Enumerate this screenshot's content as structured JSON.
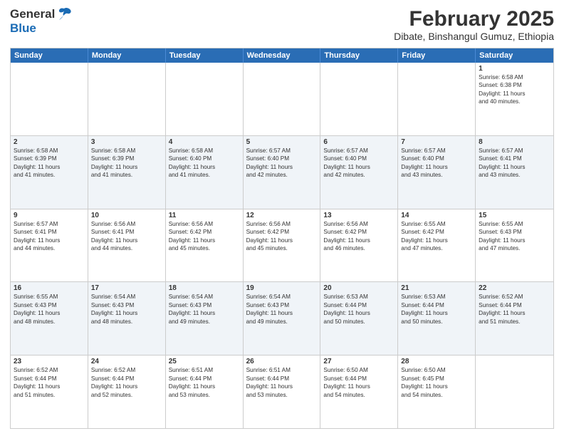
{
  "header": {
    "logo_general": "General",
    "logo_blue": "Blue",
    "title": "February 2025",
    "subtitle": "Dibate, Binshangul Gumuz, Ethiopia"
  },
  "days_of_week": [
    "Sunday",
    "Monday",
    "Tuesday",
    "Wednesday",
    "Thursday",
    "Friday",
    "Saturday"
  ],
  "weeks": [
    [
      {
        "day": "",
        "info": ""
      },
      {
        "day": "",
        "info": ""
      },
      {
        "day": "",
        "info": ""
      },
      {
        "day": "",
        "info": ""
      },
      {
        "day": "",
        "info": ""
      },
      {
        "day": "",
        "info": ""
      },
      {
        "day": "1",
        "info": "Sunrise: 6:58 AM\nSunset: 6:38 PM\nDaylight: 11 hours\nand 40 minutes."
      }
    ],
    [
      {
        "day": "2",
        "info": "Sunrise: 6:58 AM\nSunset: 6:39 PM\nDaylight: 11 hours\nand 41 minutes."
      },
      {
        "day": "3",
        "info": "Sunrise: 6:58 AM\nSunset: 6:39 PM\nDaylight: 11 hours\nand 41 minutes."
      },
      {
        "day": "4",
        "info": "Sunrise: 6:58 AM\nSunset: 6:40 PM\nDaylight: 11 hours\nand 41 minutes."
      },
      {
        "day": "5",
        "info": "Sunrise: 6:57 AM\nSunset: 6:40 PM\nDaylight: 11 hours\nand 42 minutes."
      },
      {
        "day": "6",
        "info": "Sunrise: 6:57 AM\nSunset: 6:40 PM\nDaylight: 11 hours\nand 42 minutes."
      },
      {
        "day": "7",
        "info": "Sunrise: 6:57 AM\nSunset: 6:40 PM\nDaylight: 11 hours\nand 43 minutes."
      },
      {
        "day": "8",
        "info": "Sunrise: 6:57 AM\nSunset: 6:41 PM\nDaylight: 11 hours\nand 43 minutes."
      }
    ],
    [
      {
        "day": "9",
        "info": "Sunrise: 6:57 AM\nSunset: 6:41 PM\nDaylight: 11 hours\nand 44 minutes."
      },
      {
        "day": "10",
        "info": "Sunrise: 6:56 AM\nSunset: 6:41 PM\nDaylight: 11 hours\nand 44 minutes."
      },
      {
        "day": "11",
        "info": "Sunrise: 6:56 AM\nSunset: 6:42 PM\nDaylight: 11 hours\nand 45 minutes."
      },
      {
        "day": "12",
        "info": "Sunrise: 6:56 AM\nSunset: 6:42 PM\nDaylight: 11 hours\nand 45 minutes."
      },
      {
        "day": "13",
        "info": "Sunrise: 6:56 AM\nSunset: 6:42 PM\nDaylight: 11 hours\nand 46 minutes."
      },
      {
        "day": "14",
        "info": "Sunrise: 6:55 AM\nSunset: 6:42 PM\nDaylight: 11 hours\nand 47 minutes."
      },
      {
        "day": "15",
        "info": "Sunrise: 6:55 AM\nSunset: 6:43 PM\nDaylight: 11 hours\nand 47 minutes."
      }
    ],
    [
      {
        "day": "16",
        "info": "Sunrise: 6:55 AM\nSunset: 6:43 PM\nDaylight: 11 hours\nand 48 minutes."
      },
      {
        "day": "17",
        "info": "Sunrise: 6:54 AM\nSunset: 6:43 PM\nDaylight: 11 hours\nand 48 minutes."
      },
      {
        "day": "18",
        "info": "Sunrise: 6:54 AM\nSunset: 6:43 PM\nDaylight: 11 hours\nand 49 minutes."
      },
      {
        "day": "19",
        "info": "Sunrise: 6:54 AM\nSunset: 6:43 PM\nDaylight: 11 hours\nand 49 minutes."
      },
      {
        "day": "20",
        "info": "Sunrise: 6:53 AM\nSunset: 6:44 PM\nDaylight: 11 hours\nand 50 minutes."
      },
      {
        "day": "21",
        "info": "Sunrise: 6:53 AM\nSunset: 6:44 PM\nDaylight: 11 hours\nand 50 minutes."
      },
      {
        "day": "22",
        "info": "Sunrise: 6:52 AM\nSunset: 6:44 PM\nDaylight: 11 hours\nand 51 minutes."
      }
    ],
    [
      {
        "day": "23",
        "info": "Sunrise: 6:52 AM\nSunset: 6:44 PM\nDaylight: 11 hours\nand 51 minutes."
      },
      {
        "day": "24",
        "info": "Sunrise: 6:52 AM\nSunset: 6:44 PM\nDaylight: 11 hours\nand 52 minutes."
      },
      {
        "day": "25",
        "info": "Sunrise: 6:51 AM\nSunset: 6:44 PM\nDaylight: 11 hours\nand 53 minutes."
      },
      {
        "day": "26",
        "info": "Sunrise: 6:51 AM\nSunset: 6:44 PM\nDaylight: 11 hours\nand 53 minutes."
      },
      {
        "day": "27",
        "info": "Sunrise: 6:50 AM\nSunset: 6:44 PM\nDaylight: 11 hours\nand 54 minutes."
      },
      {
        "day": "28",
        "info": "Sunrise: 6:50 AM\nSunset: 6:45 PM\nDaylight: 11 hours\nand 54 minutes."
      },
      {
        "day": "",
        "info": ""
      }
    ]
  ]
}
